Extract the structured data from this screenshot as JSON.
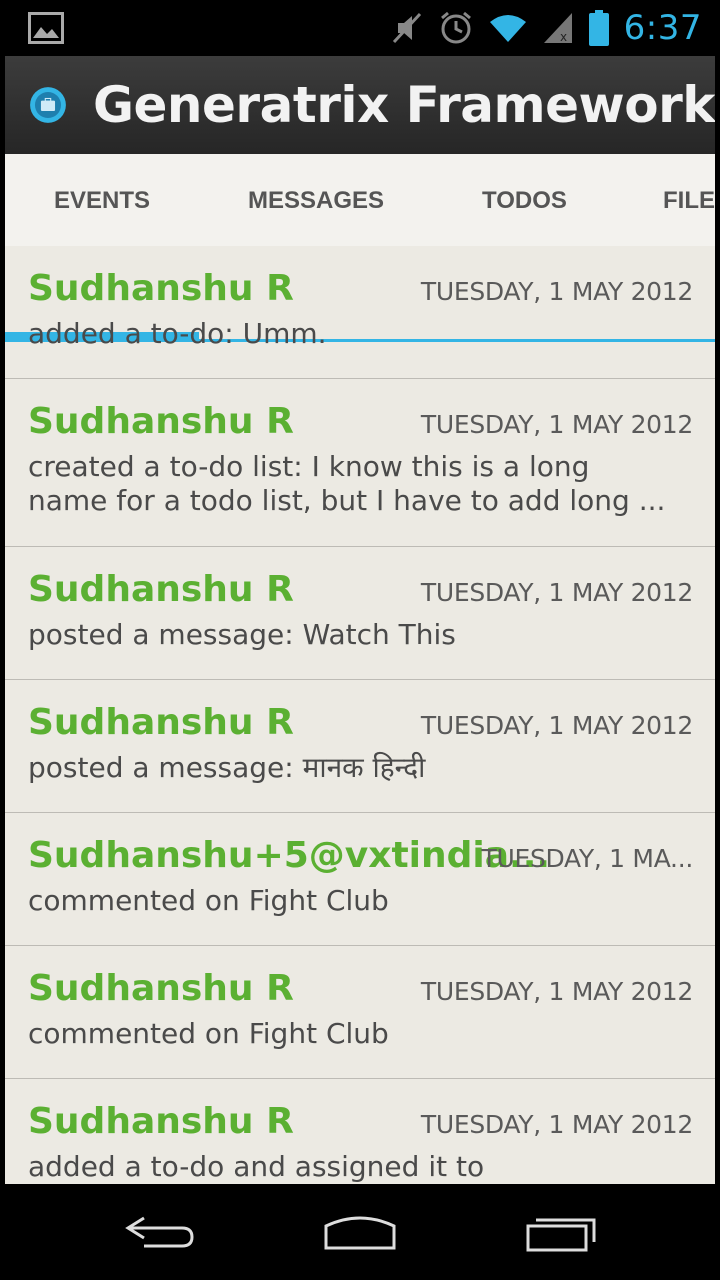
{
  "status_bar": {
    "time": "6:37",
    "icons": [
      "picture-icon",
      "mute-icon",
      "alarm-icon",
      "wifi-icon",
      "signal-icon",
      "battery-icon"
    ]
  },
  "action_bar": {
    "title": "Generatrix Framework",
    "icon": "briefcase-icon"
  },
  "tabs": [
    {
      "label": "EVENTS",
      "selected": true
    },
    {
      "label": "MESSAGES",
      "selected": false
    },
    {
      "label": "TODOS",
      "selected": false
    },
    {
      "label": "FILE",
      "selected": false
    }
  ],
  "feed": [
    {
      "author": "Sudhanshu R",
      "date": "TUESDAY, 1 MAY 2012",
      "text": "added a to-do: Umm."
    },
    {
      "author": "Sudhanshu R",
      "date": "TUESDAY, 1 MAY 2012",
      "text": "created a to-do list: I know this is a long name for a todo list, but I have to add long ..."
    },
    {
      "author": "Sudhanshu R",
      "date": "TUESDAY, 1 MAY 2012",
      "text": "posted a message: Watch This"
    },
    {
      "author": "Sudhanshu R",
      "date": "TUESDAY, 1 MAY 2012",
      "text": "posted a message: मानक हिन्दी"
    },
    {
      "author": "Sudhanshu+5@vxtindia...",
      "date": "TUESDAY, 1 MA...",
      "text": "commented on Fight Club"
    },
    {
      "author": "Sudhanshu R",
      "date": "TUESDAY, 1 MAY 2012",
      "text": "commented on Fight Club"
    },
    {
      "author": "Sudhanshu R",
      "date": "TUESDAY, 1 MAY 2012",
      "text": "added a to-do and assigned it to"
    }
  ],
  "colors": {
    "accent": "#33b5e5",
    "author": "#5bb032",
    "list_background": "#eceae3",
    "action_bar": "#2e2e2e"
  },
  "nav_bar": {
    "icons": [
      "back-icon",
      "home-icon",
      "recent-apps-icon"
    ]
  }
}
